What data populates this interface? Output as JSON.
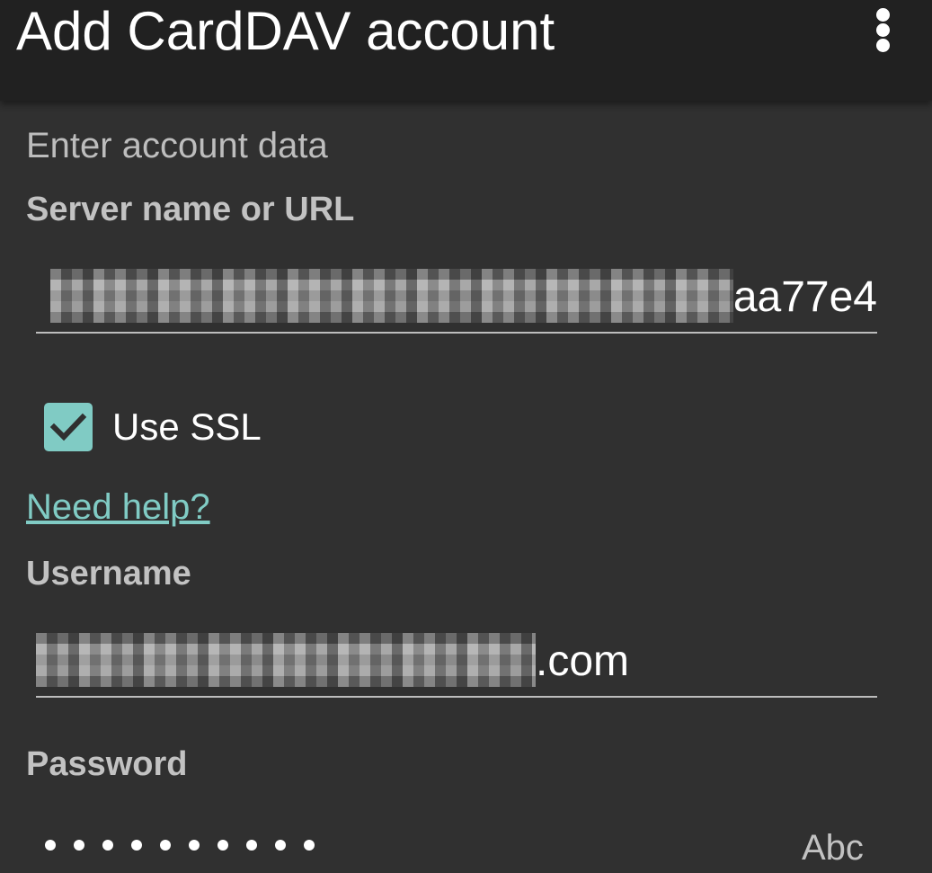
{
  "app_bar": {
    "title": "Add CardDAV account",
    "menu_icon": "more-vert-icon"
  },
  "form": {
    "section_heading": "Enter account data",
    "server": {
      "label": "Server name or URL",
      "value_visible_suffix": "aa77e4"
    },
    "use_ssl": {
      "label": "Use SSL",
      "checked": true,
      "icon": "check-icon"
    },
    "help_link": "Need help?",
    "username": {
      "label": "Username",
      "value_visible_suffix": ".com"
    },
    "password": {
      "label": "Password",
      "masked_dots": 10,
      "hint": "Abc"
    }
  },
  "colors": {
    "background": "#303030",
    "app_bar": "#212121",
    "accent": "#80cbc4",
    "text_primary": "#ffffff",
    "text_secondary": "#bdbdbd"
  }
}
